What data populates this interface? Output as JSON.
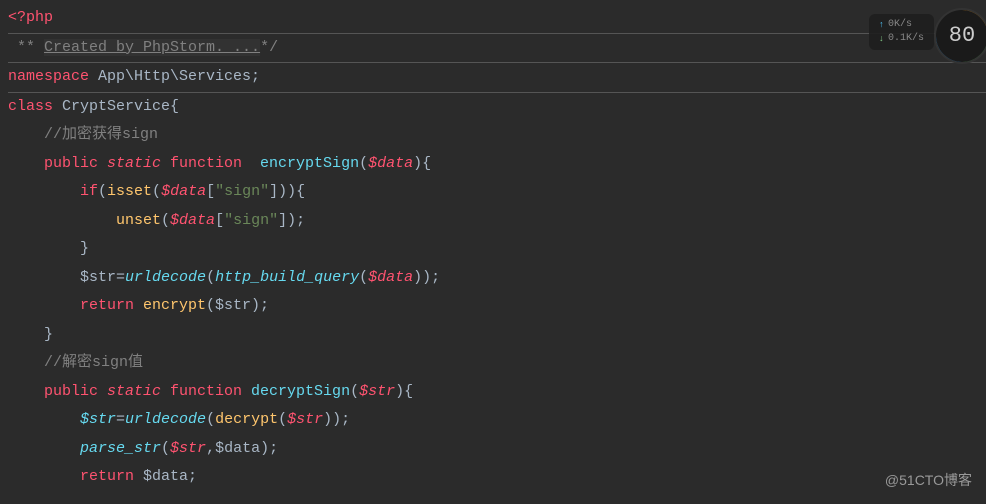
{
  "code": {
    "line1_php": "<?php",
    "line2_stars": " ** ",
    "line2_created": "Created by PhpStorm. ...",
    "line2_end": "*/",
    "line3_ns": "namespace",
    "line3_path": " App\\Http\\Services;",
    "line4_class": "class",
    "line4_name": " CryptService",
    "line4_brace": "{",
    "line5_comment": "    //加密获得sign",
    "line6_pub": "    public",
    "line6_static": " static",
    "line6_func": " function",
    "line6_name": "  encryptSign",
    "line6_paren_o": "(",
    "line6_param": "$data",
    "line6_paren_c": ")",
    "line6_brace": "{",
    "line7_if": "        if",
    "line7_paren_o": "(",
    "line7_isset": "isset",
    "line7_inner": "(",
    "line7_data": "$data",
    "line7_bracket": "[",
    "line7_str": "\"sign\"",
    "line7_bracket_c": "]))",
    "line7_brace": "{",
    "line8_unset": "            unset",
    "line8_paren_o": "(",
    "line8_data": "$data",
    "line8_bracket": "[",
    "line8_str": "\"sign\"",
    "line8_end": "]);",
    "line9_brace": "        }",
    "line10_var": "        $str",
    "line10_eq": "=",
    "line10_urldecode": "urldecode",
    "line10_paren_o": "(",
    "line10_hbq": "http_build_query",
    "line10_inner_o": "(",
    "line10_data": "$data",
    "line10_end": "));",
    "line11_return": "        return",
    "line11_enc": " encrypt",
    "line11_paren": "($str);",
    "line12_brace": "    }",
    "line13_comment": "    //解密sign值",
    "line14_pub": "    public",
    "line14_static": " static",
    "line14_func": " function",
    "line14_name": " decryptSign",
    "line14_paren_o": "(",
    "line14_param": "$str",
    "line14_end": "){",
    "line15_str": "        $str",
    "line15_eq": "=",
    "line15_urldecode": "urldecode",
    "line15_paren_o": "(",
    "line15_decrypt": "decrypt",
    "line15_inner": "(",
    "line15_param": "$str",
    "line15_end": "));",
    "line16_parse": "        parse_str",
    "line16_paren": "(",
    "line16_str": "$str",
    "line16_comma": ",",
    "line16_data": "$data);",
    "line17_return": "        return",
    "line17_data": " $data;"
  },
  "network": {
    "up": "0K/s",
    "down": "0.1K/s"
  },
  "circle": {
    "value": "80"
  },
  "watermark": "@51CTO博客"
}
